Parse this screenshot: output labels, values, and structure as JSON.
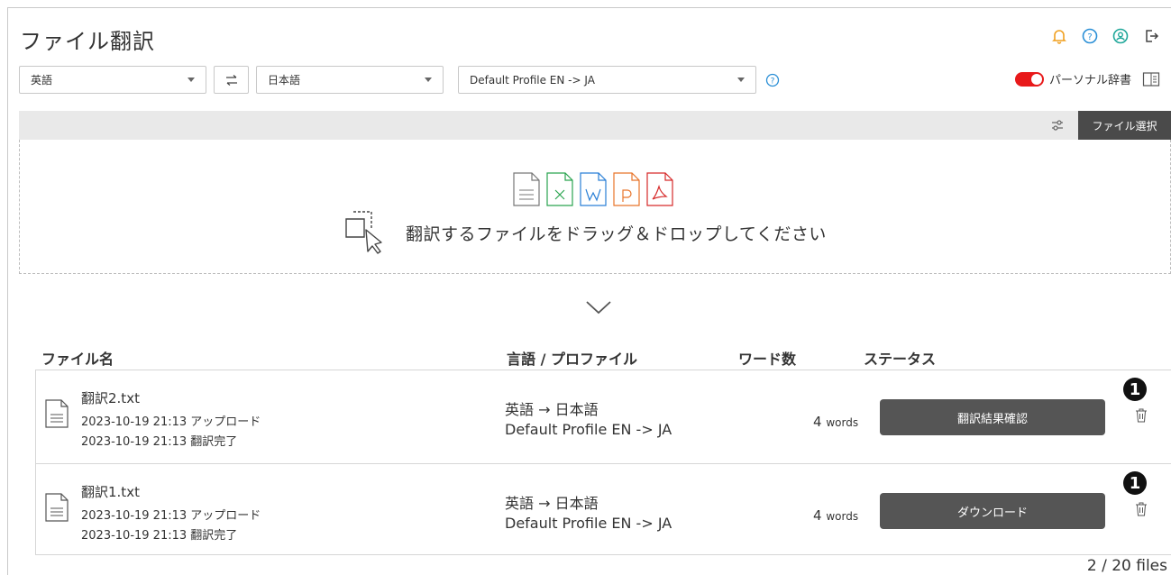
{
  "page": {
    "title": "ファイル翻訳"
  },
  "header_icons": [
    "bell-icon",
    "help-icon",
    "user-icon",
    "logout-icon"
  ],
  "toolbar": {
    "source_language": "英語",
    "target_language": "日本語",
    "profile": "Default Profile EN -> JA",
    "personal_dictionary_label": "パーソナル辞書",
    "personal_dictionary_on": true
  },
  "upload": {
    "file_select_label": "ファイル選択",
    "drop_text": "翻訳するファイルをドラッグ＆ドロップしてください",
    "file_type_icons": [
      "txt",
      "x",
      "w",
      "p",
      "pdf"
    ]
  },
  "table": {
    "headers": {
      "filename": "ファイル名",
      "language_profile": "言語 / プロファイル",
      "word_count": "ワード数",
      "status": "ステータス"
    },
    "rows": [
      {
        "filename": "翻訳2.txt",
        "uploaded": "2023-10-19 21:13 アップロード",
        "completed": "2023-10-19 21:13 翻訳完了",
        "language": "英語 → 日本語",
        "profile": "Default Profile EN -> JA",
        "words_num": "4",
        "words_unit": "words",
        "action_label": "翻訳結果確認",
        "badge": "1"
      },
      {
        "filename": "翻訳1.txt",
        "uploaded": "2023-10-19 21:13 アップロード",
        "completed": "2023-10-19 21:13 翻訳完了",
        "language": "英語 → 日本語",
        "profile": "Default Profile EN -> JA",
        "words_num": "4",
        "words_unit": "words",
        "action_label": "ダウンロード",
        "badge": "1"
      }
    ],
    "count_text": "2 / 20 files"
  },
  "colors": {
    "accent_red": "#e8191a",
    "bell_orange": "#f0a020",
    "help_blue": "#2a8fd6",
    "user_teal": "#20a79a",
    "button_dark": "#555555"
  }
}
